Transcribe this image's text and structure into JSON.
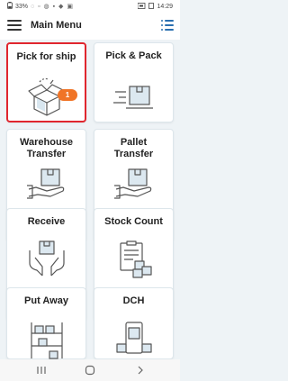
{
  "status": {
    "battery": "33%",
    "time": "14:29"
  },
  "app_bar": {
    "title": "Main Menu"
  },
  "tiles": [
    {
      "label": "Pick for ship",
      "icon": "open-box-icon",
      "badge": "1",
      "selected": true
    },
    {
      "label": "Pick & Pack",
      "icon": "box-lines-icon",
      "selected": false
    },
    {
      "label": "Warehouse\nTransfer",
      "icon": "hand-box-icon",
      "selected": false
    },
    {
      "label": "Pallet\nTransfer",
      "icon": "hand-box-icon",
      "selected": false
    },
    {
      "label": "Receive",
      "icon": "hands-receive-icon",
      "selected": false
    },
    {
      "label": "Stock Count",
      "icon": "clipboard-boxes-icon",
      "selected": false
    },
    {
      "label": "Put Away",
      "icon": "shelves-icon",
      "selected": false
    },
    {
      "label": "DCH",
      "icon": "phone-boxes-icon",
      "selected": false
    }
  ],
  "colors": {
    "accent": "#2a6fb0",
    "badge": "#f07427",
    "selection_border": "#e0262e"
  }
}
